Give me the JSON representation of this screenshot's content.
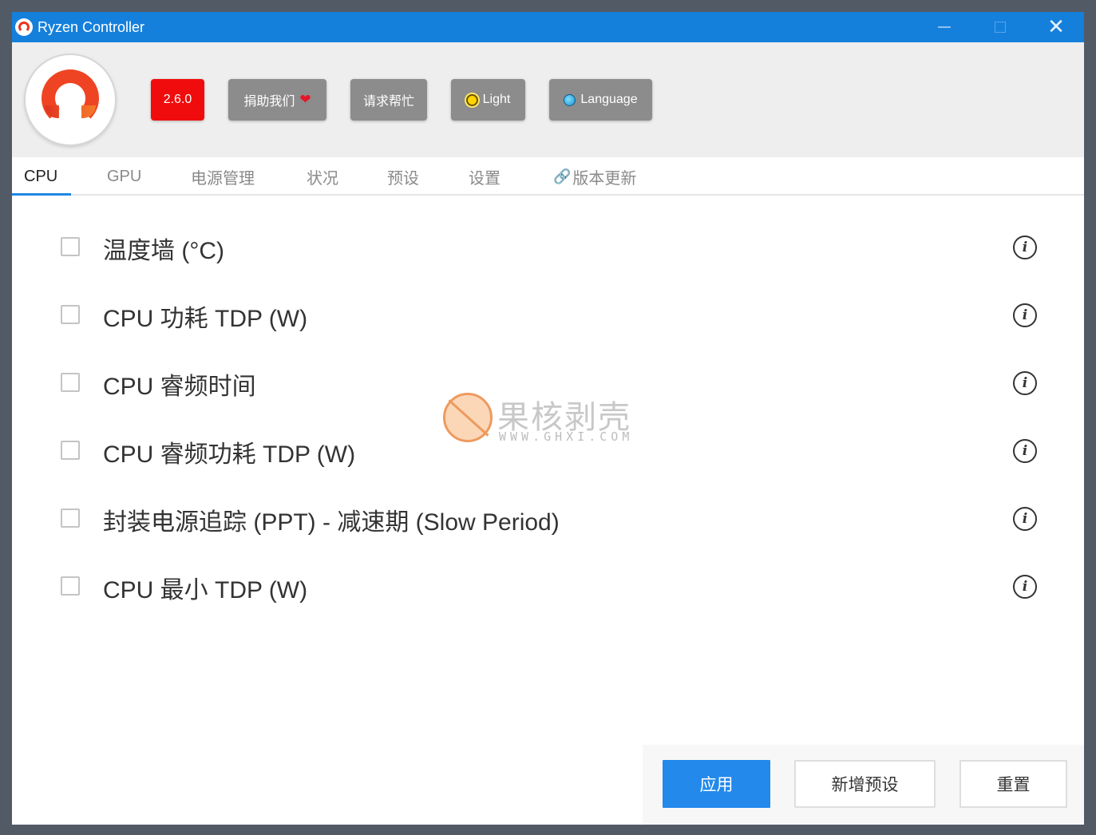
{
  "window": {
    "title": "Ryzen Controller"
  },
  "header": {
    "version_label": "2.6.0",
    "donate_label": "捐助我们",
    "help_label": "请求帮忙",
    "theme_label": "Light",
    "language_label": "Language"
  },
  "tabs": [
    {
      "label": "CPU",
      "active": true
    },
    {
      "label": "GPU"
    },
    {
      "label": "电源管理"
    },
    {
      "label": "状况"
    },
    {
      "label": "预设"
    },
    {
      "label": "设置"
    },
    {
      "label": "版本更新"
    }
  ],
  "settings": [
    {
      "label": "温度墙 (°C)",
      "checked": false
    },
    {
      "label": "CPU 功耗 TDP (W)",
      "checked": false
    },
    {
      "label": "CPU 睿频时间",
      "checked": false
    },
    {
      "label": "CPU 睿频功耗 TDP (W)",
      "checked": false
    },
    {
      "label": "封装电源追踪 (PPT) - 减速期 (Slow Period)",
      "checked": false
    },
    {
      "label": "CPU 最小 TDP (W)",
      "checked": false
    }
  ],
  "info_glyph": "i",
  "watermark": {
    "text": "果核剥壳",
    "url": "WWW.GHXI.COM"
  },
  "footer": {
    "apply_label": "应用",
    "add_preset_label": "新增预设",
    "reset_label": "重置"
  },
  "colors": {
    "titlebar": "#1580dc",
    "version_badge": "#f00c0c",
    "header_button": "#8c8c8c",
    "primary_button": "#2389eb",
    "tab_accent": "#1e88e5"
  },
  "icons": {
    "app": "ryzen-logo-icon",
    "donate": "heart-icon",
    "theme": "sun-icon",
    "language": "globe-icon",
    "update_tab": "link-icon",
    "setting_help": "info-icon"
  }
}
